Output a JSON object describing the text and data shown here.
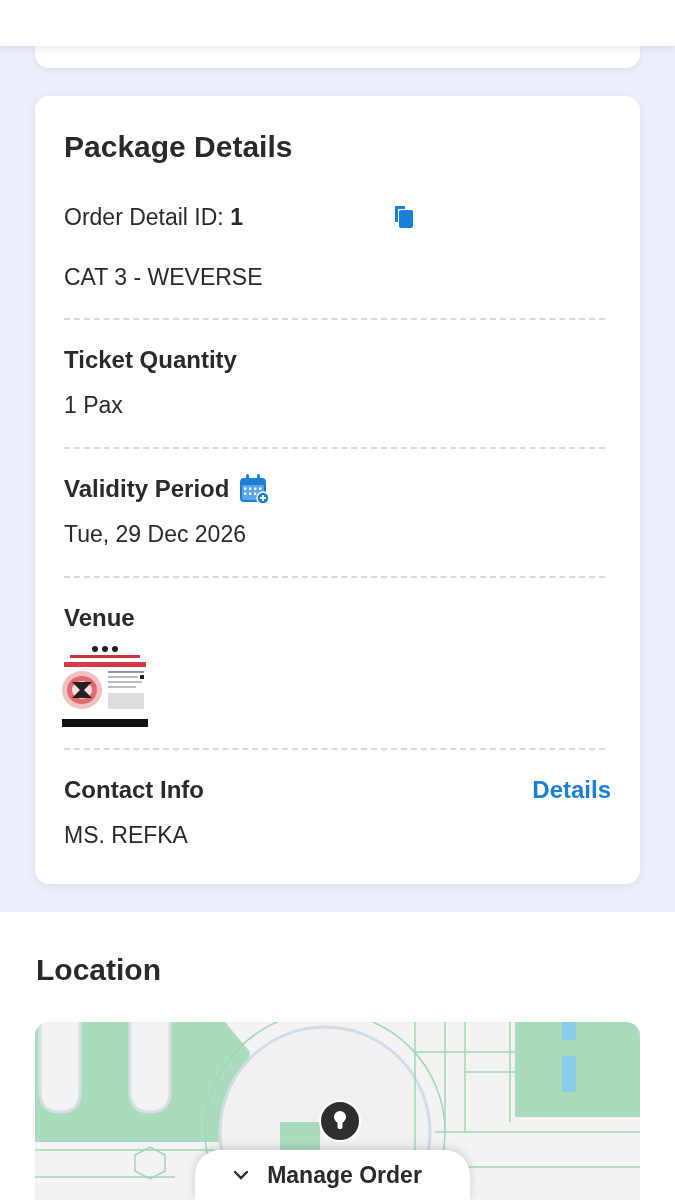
{
  "package_details": {
    "title": "Package Details",
    "order_detail_id": {
      "label": "Order Detail ID:",
      "value": "1"
    },
    "package_name": "CAT 3 - WEVERSE",
    "sections": [
      {
        "kind": "text",
        "label": "Ticket Quantity",
        "value": "1 Pax"
      },
      {
        "kind": "date",
        "label": "Validity Period",
        "value": "Tue, 29 Dec 2026"
      },
      {
        "kind": "image",
        "label": "Venue"
      },
      {
        "kind": "link",
        "label": "Contact Info",
        "link": "Details",
        "value": "MS. REFKA"
      }
    ]
  },
  "location": {
    "title": "Location"
  },
  "manage_order": {
    "label": "Manage Order"
  }
}
